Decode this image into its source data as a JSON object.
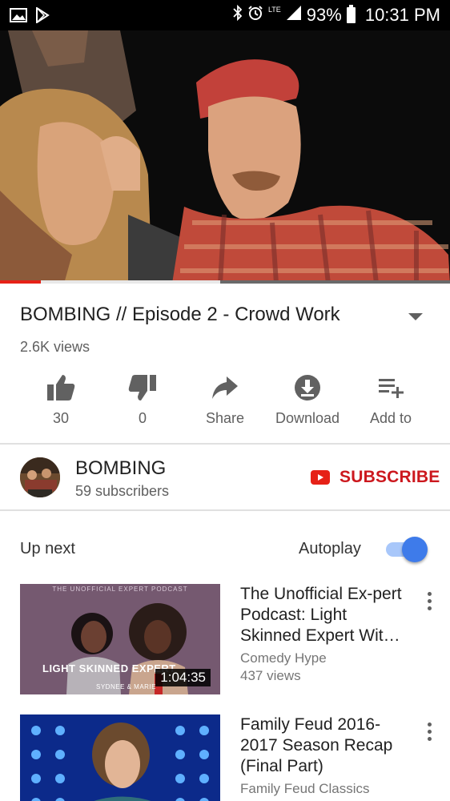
{
  "status_bar": {
    "network_label": "LTE",
    "battery": "93%",
    "time": "10:31 PM"
  },
  "player": {
    "played_fraction": 0.09,
    "buffered_fraction": 0.49
  },
  "video": {
    "title": "BOMBING // Episode 2 - Crowd Work",
    "views": "2.6K views"
  },
  "actions": {
    "like_count": "30",
    "dislike_count": "0",
    "share_label": "Share",
    "download_label": "Download",
    "add_to_label": "Add to"
  },
  "channel": {
    "name": "BOMBING",
    "subscribers": "59 subscribers",
    "subscribe_label": "SUBSCRIBE"
  },
  "up_next": {
    "label": "Up next",
    "autoplay_label": "Autoplay",
    "autoplay_on": true
  },
  "recommendations": [
    {
      "title": "The Unofficial Ex-pert Podcast: Light Skinned Expert Wit…",
      "channel": "Comedy Hype",
      "views": "437 views",
      "duration": "1:04:35",
      "thumb_header": "THE UNOFFICIAL EXPERT PODCAST",
      "thumb_caption": "LIGHT SKINNED EXPERT",
      "thumb_names": "SYDNEE & MARIE"
    },
    {
      "title": "Family Feud 2016-2017 Season Recap (Final Part)",
      "channel": "Family Feud Classics"
    }
  ],
  "colors": {
    "accent_red": "#cc181e",
    "progress_red": "#e62117",
    "toggle_blue": "#3e7bea"
  },
  "icons": {
    "status_left": [
      "gallery-icon",
      "play-store-icon"
    ],
    "status_right": [
      "bluetooth-icon",
      "alarm-icon",
      "signal-icon",
      "battery-icon"
    ],
    "actions": [
      "thumbs-up-icon",
      "thumbs-down-icon",
      "share-arrow-icon",
      "download-icon",
      "playlist-add-icon"
    ],
    "subscribe": "youtube-logo-icon",
    "overflow": "more-vert-icon"
  }
}
